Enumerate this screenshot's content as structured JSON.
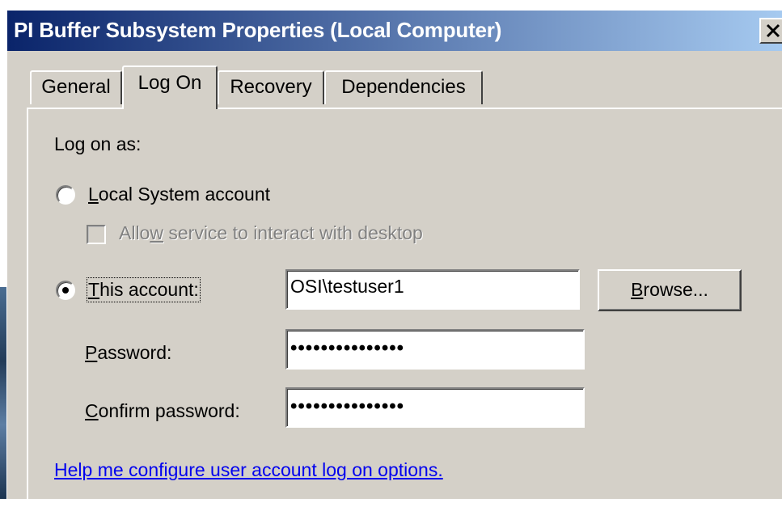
{
  "window": {
    "title": "PI Buffer Subsystem Properties (Local Computer)",
    "close_glyph": "✕",
    "title_gradient_start": "#0a246a",
    "title_gradient_end": "#a6caf0"
  },
  "tabs": [
    {
      "label": "General",
      "active": false
    },
    {
      "label": "Log On",
      "active": true
    },
    {
      "label": "Recovery",
      "active": false
    },
    {
      "label": "Dependencies",
      "active": false
    }
  ],
  "logon": {
    "section_label": "Log on as:",
    "local_system": {
      "label_mnemonic": "L",
      "label_rest": "ocal System account",
      "selected": false
    },
    "interact_desktop": {
      "label_before": "Allo",
      "label_mnemonic": "w",
      "label_after": " service to interact with desktop",
      "checked": false,
      "enabled": false
    },
    "this_account": {
      "label_mnemonic": "T",
      "label_rest": "his account:",
      "selected": true,
      "value": "OSI\\testuser1"
    },
    "browse_button": {
      "label_mnemonic": "B",
      "label_rest": "rowse..."
    },
    "password": {
      "label_mnemonic": "P",
      "label_rest": "assword:",
      "masked_value": "•••••••••••••••"
    },
    "confirm_password": {
      "label_mnemonic": "C",
      "label_rest": "onfirm password:",
      "masked_value": "•••••••••••••••"
    },
    "help_link": "Help me configure user account log on options."
  },
  "colors": {
    "dialog_face": "#d4d0c8",
    "link": "#0000ee",
    "disabled_text": "#808080"
  },
  "icons": {
    "close": "close-icon"
  }
}
